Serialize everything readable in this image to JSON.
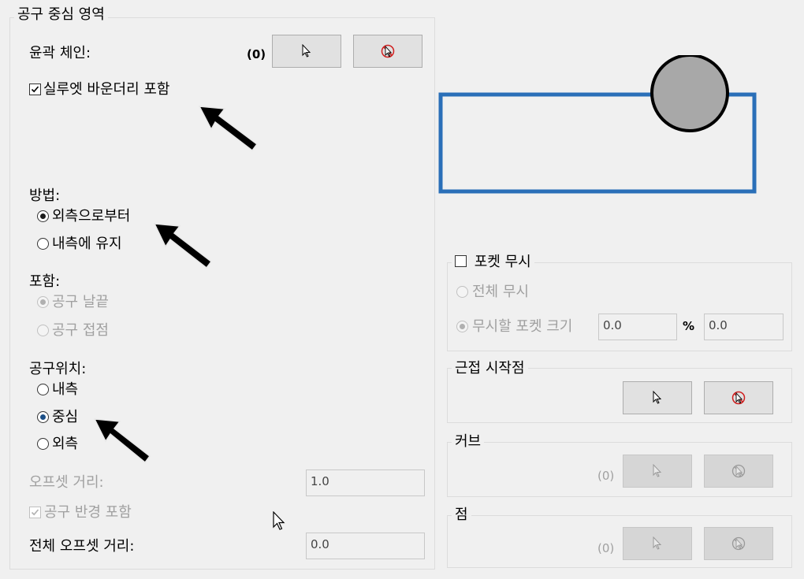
{
  "tool_area": {
    "title": "공구 중심 영역",
    "contour_chain_label": "윤곽 체인:",
    "contour_chain_count": "(0)",
    "include_silhouette_label": "실루엣 바운더리 포함",
    "method_label": "방법:",
    "method_options": [
      "외측으로부터",
      "내측에 유지"
    ],
    "include_label": "포함:",
    "include_options": [
      "공구 날끝",
      "공구 접점"
    ],
    "tool_position_label": "공구위치:",
    "tool_position_options": [
      "내측",
      "중심",
      "외측"
    ],
    "offset_distance_label": "오프셋 거리:",
    "offset_distance_value": "1.0",
    "include_tool_radius_label": "공구 반경 포함",
    "total_offset_label": "전체 오프셋 거리:",
    "total_offset_value": "0.0"
  },
  "pocket_ignore": {
    "title": "포켓 무시",
    "ignore_all_label": "전체 무시",
    "ignore_size_label": "무시할 포켓 크기",
    "size_value_1": "0.0",
    "percent_symbol": "%",
    "size_value_2": "0.0"
  },
  "approach_start": {
    "title": "근접 시작점"
  },
  "curve": {
    "title": "커브",
    "count": "(0)"
  },
  "point": {
    "title": "점",
    "count": "(0)"
  },
  "colors": {
    "preview_rect": "#2a6fb8",
    "preview_circle": "#a8a8a8"
  }
}
